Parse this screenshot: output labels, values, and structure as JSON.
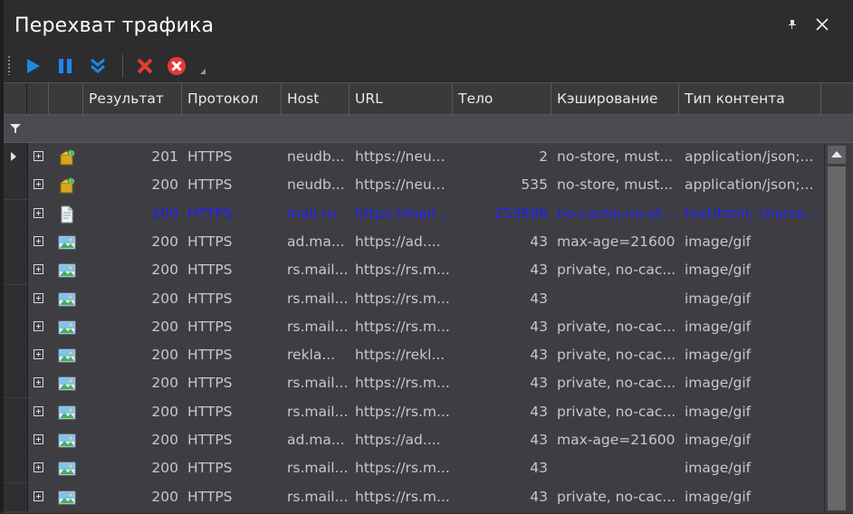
{
  "window": {
    "title": "Перехват трафика"
  },
  "columns": [
    "Результат",
    "Протокол",
    "Host",
    "URL",
    "Тело",
    "Кэширование",
    "Тип контента"
  ],
  "rows": [
    {
      "icon": "json-package-icon",
      "result": "201",
      "protocol": "HTTPS",
      "host": "neudb...",
      "url": "https://neu...",
      "body": "2",
      "caching": "no-store, must...",
      "ctype": "application/json;...",
      "selected": false,
      "current": true
    },
    {
      "icon": "json-package-icon",
      "result": "200",
      "protocol": "HTTPS",
      "host": "neudb...",
      "url": "https://neu...",
      "body": "535",
      "caching": "no-store, must...",
      "ctype": "application/json;...",
      "selected": false,
      "current": false
    },
    {
      "icon": "document-icon",
      "result": "200",
      "protocol": "HTTPS",
      "host": "mail.ru",
      "url": "https://mail...",
      "body": "253696",
      "caching": "no-cache,no-st...",
      "ctype": "text/html; charse...",
      "selected": true,
      "current": false
    },
    {
      "icon": "image-icon",
      "result": "200",
      "protocol": "HTTPS",
      "host": "ad.ma...",
      "url": "https://ad....",
      "body": "43",
      "caching": "max-age=21600",
      "ctype": "image/gif",
      "selected": false,
      "current": false
    },
    {
      "icon": "image-icon",
      "result": "200",
      "protocol": "HTTPS",
      "host": "rs.mail...",
      "url": "https://rs.m...",
      "body": "43",
      "caching": "private, no-cac...",
      "ctype": "image/gif",
      "selected": false,
      "current": false
    },
    {
      "icon": "image-icon",
      "result": "200",
      "protocol": "HTTPS",
      "host": "rs.mail...",
      "url": "https://rs.m...",
      "body": "43",
      "caching": "",
      "ctype": "image/gif",
      "selected": false,
      "current": false
    },
    {
      "icon": "image-icon",
      "result": "200",
      "protocol": "HTTPS",
      "host": "rs.mail...",
      "url": "https://rs.m...",
      "body": "43",
      "caching": "private, no-cac...",
      "ctype": "image/gif",
      "selected": false,
      "current": false
    },
    {
      "icon": "image-icon",
      "result": "200",
      "protocol": "HTTPS",
      "host": "rekla...",
      "url": "https://rekl...",
      "body": "43",
      "caching": "private, no-cac...",
      "ctype": "image/gif",
      "selected": false,
      "current": false
    },
    {
      "icon": "image-icon",
      "result": "200",
      "protocol": "HTTPS",
      "host": "rs.mail...",
      "url": "https://rs.m...",
      "body": "43",
      "caching": "private, no-cac...",
      "ctype": "image/gif",
      "selected": false,
      "current": false
    },
    {
      "icon": "image-icon",
      "result": "200",
      "protocol": "HTTPS",
      "host": "rs.mail...",
      "url": "https://rs.m...",
      "body": "43",
      "caching": "private, no-cac...",
      "ctype": "image/gif",
      "selected": false,
      "current": false
    },
    {
      "icon": "image-icon",
      "result": "200",
      "protocol": "HTTPS",
      "host": "ad.ma...",
      "url": "https://ad....",
      "body": "43",
      "caching": "max-age=21600",
      "ctype": "image/gif",
      "selected": false,
      "current": false
    },
    {
      "icon": "image-icon",
      "result": "200",
      "protocol": "HTTPS",
      "host": "rs.mail...",
      "url": "https://rs.m...",
      "body": "43",
      "caching": "",
      "ctype": "image/gif",
      "selected": false,
      "current": false
    },
    {
      "icon": "image-icon",
      "result": "200",
      "protocol": "HTTPS",
      "host": "rs.mail...",
      "url": "https://rs.m...",
      "body": "43",
      "caching": "private, no-cac...",
      "ctype": "image/gif",
      "selected": false,
      "current": false
    }
  ],
  "colors": {
    "background": "#2d2d30",
    "grid": "#3e3e42",
    "selected_text": "#1f1fff",
    "text": "#c8c8c8",
    "play": "#1e88e5",
    "stop": "#e53935"
  }
}
